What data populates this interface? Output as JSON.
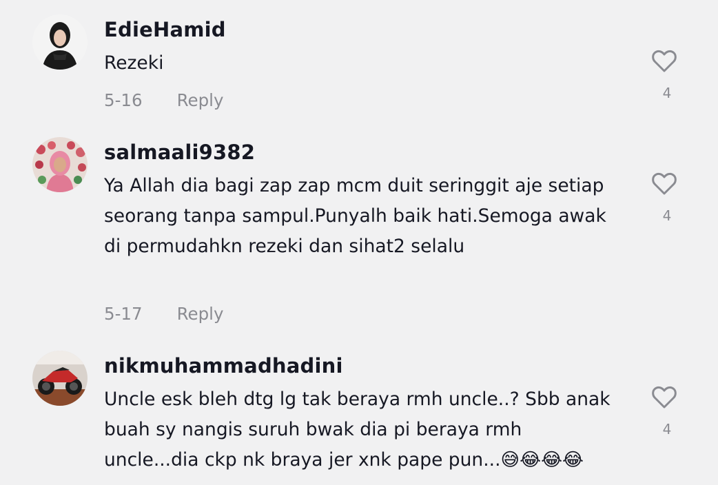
{
  "comments": [
    {
      "username": "EdieHamid",
      "text": "Rezeki",
      "date": "5-16",
      "reply_label": "Reply",
      "like_count": "4",
      "like_icon": "heart-outline-icon"
    },
    {
      "username": "salmaali9382",
      "text": "Ya Allah dia bagi zap zap mcm duit seringgit aje setiap seorang tanpa sampul.Punyalh baik hati.Semoga awak di permudahkn rezeki dan sihat2 selalu",
      "date": "5-17",
      "reply_label": "Reply",
      "like_count": "4",
      "like_icon": "heart-outline-icon"
    },
    {
      "username": "nikmuhammadhadini",
      "text": "Uncle esk bleh dtg lg tak beraya rmh uncle..? Sbb anak buah sy nangis suruh bwak dia pi beraya rmh uncle...dia ckp nk braya jer xnk pape pun...😅😂😂😂",
      "like_count": "4",
      "like_icon": "heart-outline-icon"
    }
  ],
  "colors": {
    "background": "#f1f1f2",
    "text": "#161823",
    "muted": "#8a8b91"
  }
}
